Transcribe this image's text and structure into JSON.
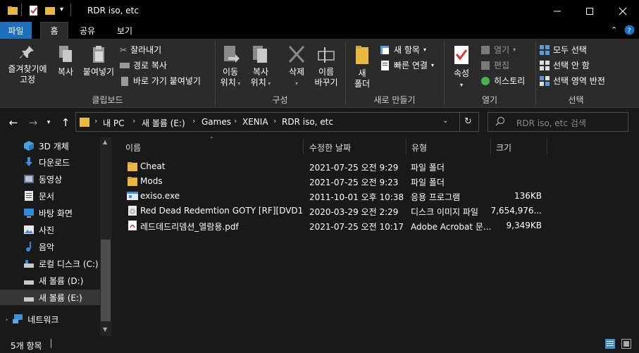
{
  "window": {
    "title": "RDR iso, etc"
  },
  "ribbon_tabs": [
    "파일",
    "홈",
    "공유",
    "보기"
  ],
  "ribbon": {
    "clipboard": {
      "pin_label_1": "즐겨찾기에",
      "pin_label_2": "고정",
      "copy": "복사",
      "paste": "붙여넣기",
      "cut": "잘라내기",
      "copy_path": "경로 복사",
      "paste_shortcut": "바로 가기 붙여넣기",
      "group": "클립보드"
    },
    "organize": {
      "move_1": "이동",
      "move_2": "위치",
      "copyto_1": "복사",
      "copyto_2": "위치",
      "delete": "삭제",
      "rename_1": "이름",
      "rename_2": "바꾸기",
      "group": "구성"
    },
    "new": {
      "folder_1": "새",
      "folder_2": "폴더",
      "new_item": "새 항목",
      "easy_access": "빠른 연결",
      "group": "새로 만들기"
    },
    "open": {
      "properties": "속성",
      "open": "열기",
      "edit": "편집",
      "history": "히스토리",
      "group": "열기"
    },
    "select": {
      "select_all": "모두 선택",
      "select_none": "선택 안 함",
      "invert": "선택 영역 반전",
      "group": "선택"
    }
  },
  "address": {
    "crumbs": [
      "내 PC",
      "새 볼륨 (E:)",
      "Games",
      "XENIA",
      "RDR iso, etc"
    ],
    "search_placeholder": "RDR iso, etc 검색"
  },
  "nav": [
    {
      "label": "3D 개체",
      "icon": "3d-objects-icon"
    },
    {
      "label": "다운로드",
      "icon": "download-icon"
    },
    {
      "label": "동영상",
      "icon": "video-icon"
    },
    {
      "label": "문서",
      "icon": "document-icon"
    },
    {
      "label": "바탕 화면",
      "icon": "desktop-icon"
    },
    {
      "label": "사진",
      "icon": "pictures-icon"
    },
    {
      "label": "음악",
      "icon": "music-icon"
    },
    {
      "label": "로컬 디스크 (C:)",
      "icon": "drive-icon"
    },
    {
      "label": "새 볼륨 (D:)",
      "icon": "drive-icon"
    },
    {
      "label": "새 볼륨 (E:)",
      "icon": "drive-icon"
    },
    {
      "label": "네트워크",
      "icon": "network-icon"
    }
  ],
  "columns": [
    "이름",
    "수정한 날짜",
    "유형",
    "크기"
  ],
  "files": [
    {
      "name": "Cheat",
      "date": "2021-07-25 오전 9:29",
      "type": "파일 폴더",
      "size": "",
      "icon": "folder-icon"
    },
    {
      "name": "Mods",
      "date": "2021-07-25 오전 9:23",
      "type": "파일 폴더",
      "size": "",
      "icon": "folder-icon"
    },
    {
      "name": "exiso.exe",
      "date": "2011-10-01 오후 10:38",
      "type": "응용 프로그램",
      "size": "136KB",
      "icon": "exe-icon"
    },
    {
      "name": "Red Dead Redemtion GOTY [RF][DVD1]....",
      "date": "2020-03-29 오전 2:29",
      "type": "디스크 이미지 파일",
      "size": "7,654,976...",
      "icon": "disc-image-icon"
    },
    {
      "name": "레드데드리뎀션_열람용.pdf",
      "date": "2021-07-25 오전 10:17",
      "type": "Adobe Acrobat 문...",
      "size": "9,349KB",
      "icon": "pdf-icon"
    }
  ],
  "status": {
    "count": "5개 항목"
  }
}
